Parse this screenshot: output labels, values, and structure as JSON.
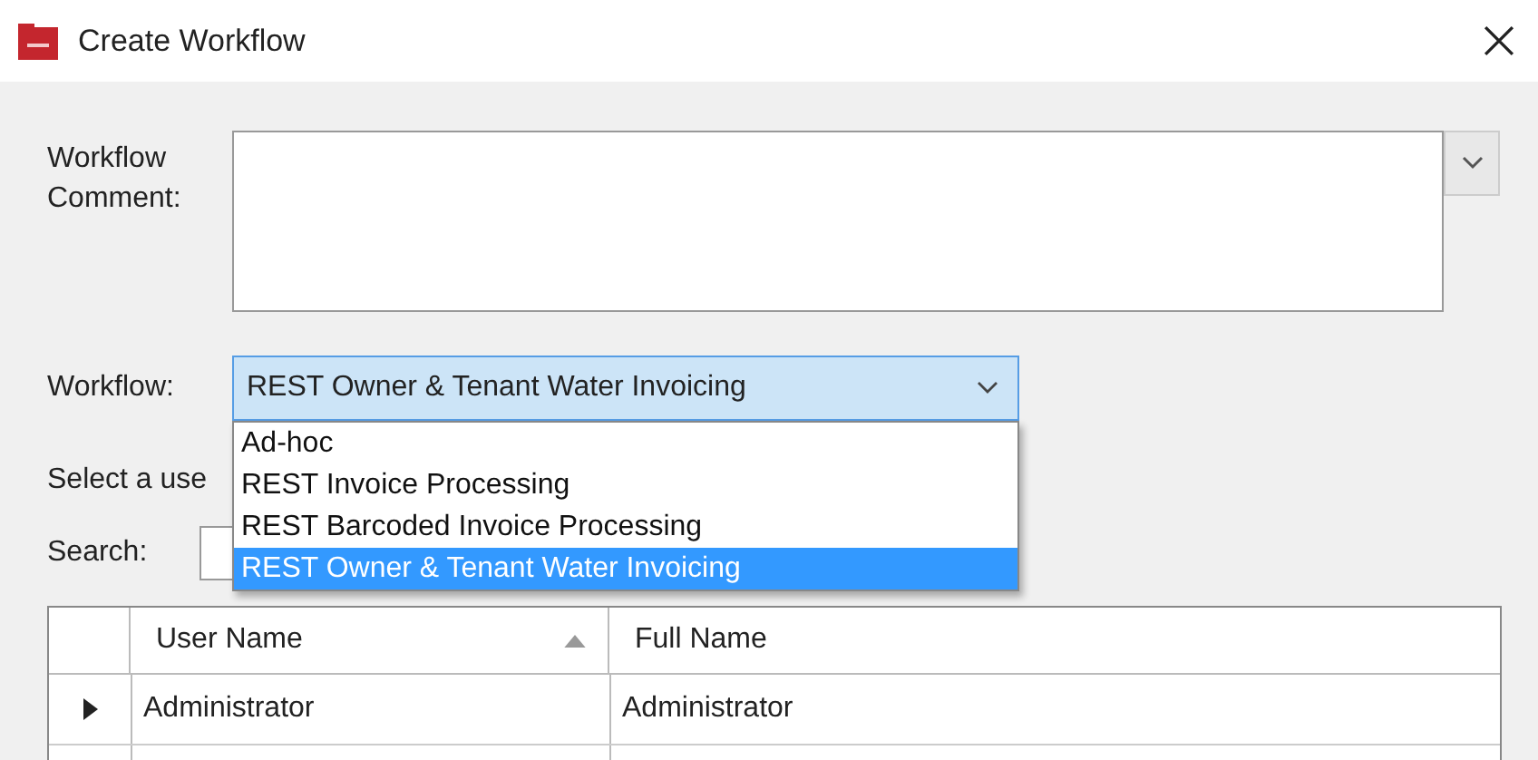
{
  "window": {
    "title": "Create Workflow"
  },
  "comment": {
    "label": "Workflow Comment:"
  },
  "workflow": {
    "label": "Workflow:",
    "value": "REST Owner & Tenant Water Invoicing",
    "expanded": true,
    "options": [
      {
        "label": "Ad-hoc",
        "selected": false
      },
      {
        "label": "REST Invoice Processing",
        "selected": false
      },
      {
        "label": "REST Barcoded Invoice Processing",
        "selected": false
      },
      {
        "label": "REST Owner & Tenant Water Invoicing",
        "selected": true
      }
    ]
  },
  "user_prompt": "Select a use",
  "search": {
    "label": "Search:"
  },
  "table": {
    "columns": [
      {
        "label": "User Name",
        "sorted": true
      },
      {
        "label": "Full Name",
        "sorted": false
      }
    ],
    "rows": [
      {
        "cells": [
          "Administrator",
          "Administrator"
        ],
        "current": true
      }
    ]
  }
}
